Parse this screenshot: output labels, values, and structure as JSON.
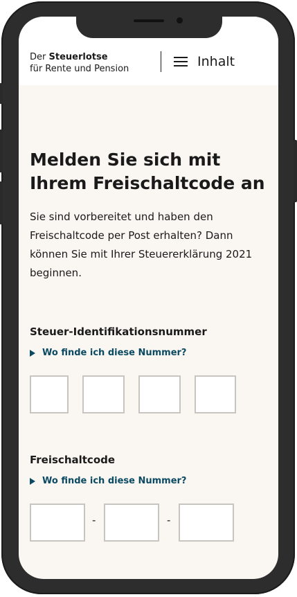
{
  "header": {
    "brand_prefix": "Der ",
    "brand_strong": "Steuerlotse",
    "brand_line2": "für Rente und Pension",
    "menu_label": "Inhalt"
  },
  "page": {
    "title": "Melden Sie sich mit Ihrem Freischaltcode an",
    "intro": "Sie sind vorbereitet und haben den Freischaltcode per Post erhalten? Dann können Sie mit Ihrer Steuererklärung 2021 beginnen."
  },
  "tax_id": {
    "label": "Steuer-Identifikationsnummer",
    "help_link": "Wo finde ich diese Nummer?",
    "inputs": [
      "",
      "",
      "",
      ""
    ]
  },
  "unlock_code": {
    "label": "Freischaltcode",
    "help_link": "Wo finde ich diese Nummer?",
    "inputs": [
      "",
      "",
      ""
    ],
    "separator": "-"
  },
  "colors": {
    "background": "#faf6f2",
    "link": "#0b4a63",
    "text": "#1a1a1a",
    "input_border": "#c8c4bf"
  }
}
